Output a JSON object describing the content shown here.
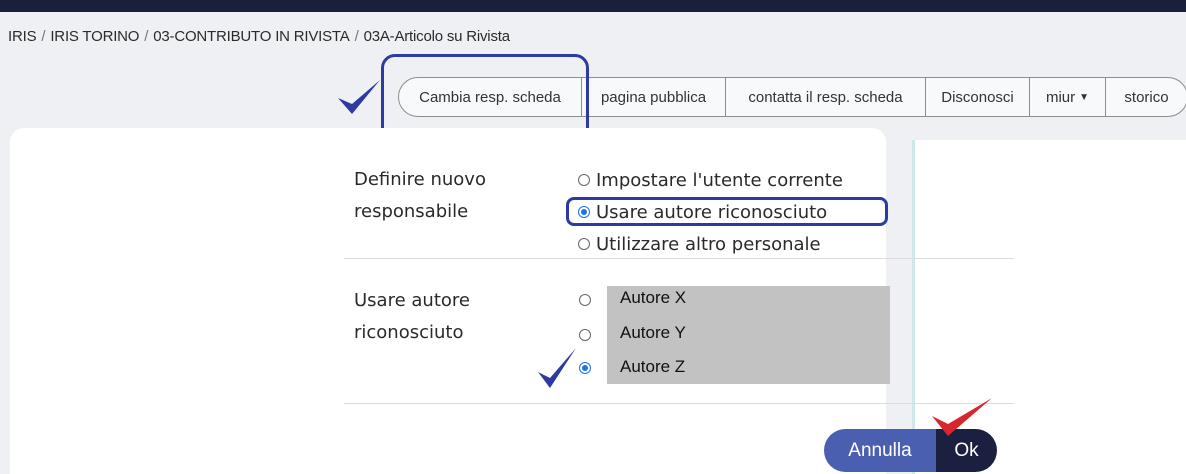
{
  "breadcrumb": {
    "items": [
      "IRIS",
      "IRIS TORINO",
      "03-CONTRIBUTO IN RIVISTA",
      "03A-Articolo su Rivista"
    ],
    "separator": "/"
  },
  "toolbar": {
    "buttons": [
      "Cambia resp. scheda",
      "pagina pubblica",
      "contatta il resp. scheda",
      "Disconosci",
      "miur",
      "storico"
    ]
  },
  "form": {
    "section1": {
      "label_line1": "Definire nuovo",
      "label_line2": "responsabile",
      "options": [
        "Impostare l'utente corrente",
        "Usare autore riconosciuto",
        "Utilizzare altro personale"
      ],
      "selected_index": 1
    },
    "section2": {
      "label_line1": "Usare autore",
      "label_line2": "riconosciuto",
      "options": [
        "Autore X",
        "Autore Y",
        "Autore Z"
      ],
      "selected_index": 2
    }
  },
  "actions": {
    "cancel_label": "Annulla",
    "ok_label": "Ok"
  },
  "colors": {
    "annotation_blue": "#2e3aa3",
    "annotation_red": "#d9262e",
    "cancel_button": "#4b5fb0",
    "ok_button": "#1c2040"
  }
}
